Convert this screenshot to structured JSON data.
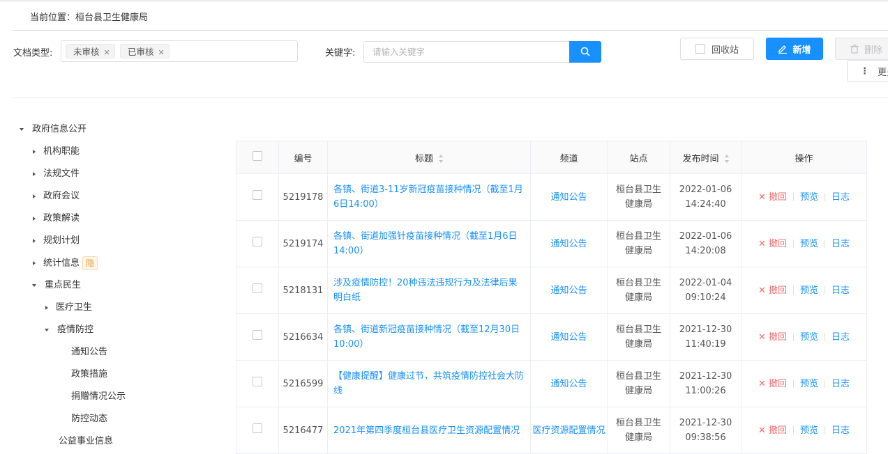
{
  "breadcrumb": "当前位置：桓台县卫生健康局",
  "filters": {
    "doctype_label": "文档类型:",
    "tags": [
      "未审核",
      "已审核"
    ],
    "keyword_label": "关键字:",
    "keyword_placeholder": "请输入关键字",
    "keyword_value": ""
  },
  "toolbar": {
    "recycle_label": "回收站",
    "add_label": "新增",
    "delete_label": "删除",
    "more_label": "更多"
  },
  "tree": [
    {
      "label": "政府信息公开",
      "expanded": true
    },
    {
      "label": "机构职能"
    },
    {
      "label": "法规文件"
    },
    {
      "label": "政府会议"
    },
    {
      "label": "政策解读"
    },
    {
      "label": "规划计划"
    },
    {
      "label": "统计信息",
      "badge": "隐"
    },
    {
      "label": "重点民生",
      "expanded": true
    },
    {
      "label": "医疗卫生"
    },
    {
      "label": "疫情防控",
      "expanded": true
    },
    {
      "label": "通知公告"
    },
    {
      "label": "政策措施"
    },
    {
      "label": "捐赠情况公示"
    },
    {
      "label": "防控动态"
    },
    {
      "label": "公益事业信息"
    }
  ],
  "table": {
    "headers": [
      "编号",
      "标题",
      "频道",
      "站点",
      "发布时间",
      "操作"
    ],
    "ops": {
      "revoke": "撤回",
      "preview": "预览",
      "log": "日志"
    },
    "rows": [
      {
        "id": "5219178",
        "title": "各镇、街道3-11岁新冠疫苗接种情况（截至1月6日14:00）",
        "channel": "通知公告",
        "site": "桓台县卫生健康局",
        "date": "2022-01-06",
        "time": "14:24:40"
      },
      {
        "id": "5219174",
        "title": "各镇、街道加强针疫苗接种情况（截至1月6日14:00）",
        "channel": "通知公告",
        "site": "桓台县卫生健康局",
        "date": "2022-01-06",
        "time": "14:20:08"
      },
      {
        "id": "5218131",
        "title": "涉及疫情防控！20种违法违规行为及法律后果明白纸",
        "channel": "通知公告",
        "site": "桓台县卫生健康局",
        "date": "2022-01-04",
        "time": "09:10:24"
      },
      {
        "id": "5216634",
        "title": "各镇、街道新冠疫苗接种情况（截至12月30日10:00）",
        "channel": "通知公告",
        "site": "桓台县卫生健康局",
        "date": "2021-12-30",
        "time": "11:40:19"
      },
      {
        "id": "5216599",
        "title": "【健康提醒】健康过节，共筑疫情防控社会大防线",
        "channel": "通知公告",
        "site": "桓台县卫生健康局",
        "date": "2021-12-30",
        "time": "11:00:26"
      },
      {
        "id": "5216477",
        "title": "2021年第四季度桓台县医疗卫生资源配置情况",
        "channel": "医疗资源配置情况",
        "site": "桓台县卫生健康局",
        "date": "2021-12-30",
        "time": "09:38:56"
      }
    ]
  },
  "colors": {
    "primary": "#1890ff",
    "danger": "#f56c6c",
    "warning": "#e6a23c"
  }
}
